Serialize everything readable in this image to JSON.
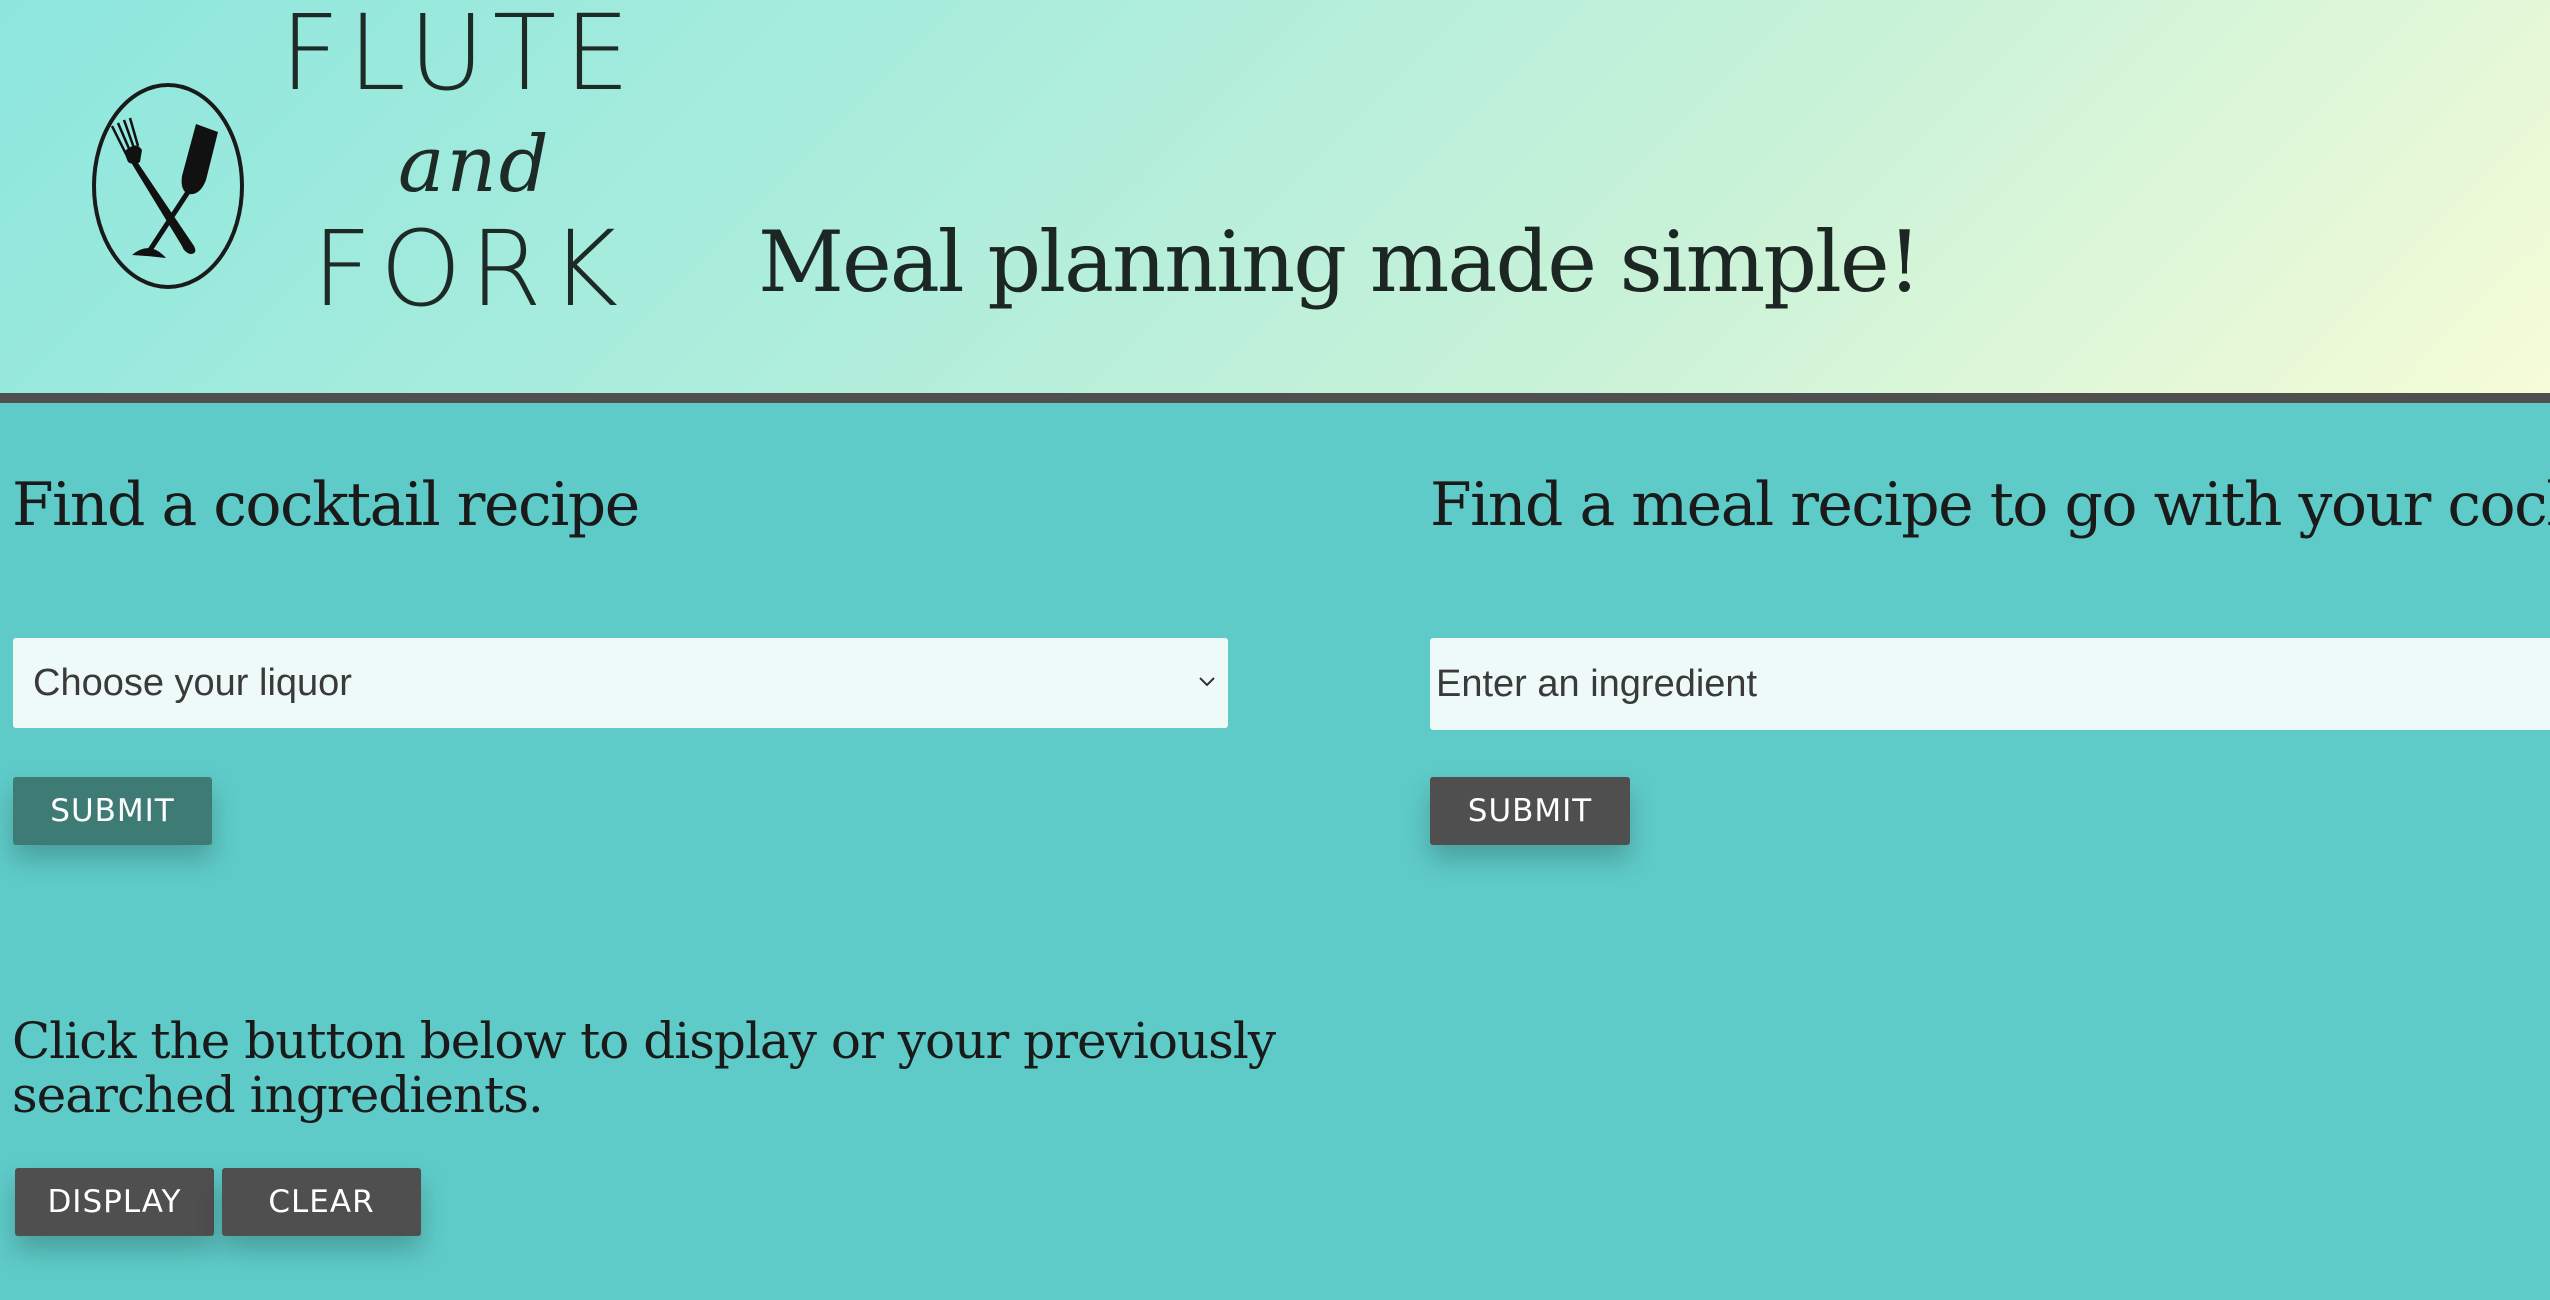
{
  "header": {
    "brand": {
      "line1": "FLUTE",
      "line2": "and",
      "line3": "FORK"
    },
    "tagline": "Meal planning made simple!"
  },
  "cocktail": {
    "title": "Find a cocktail recipe",
    "select": {
      "selected": "Choose your liquor"
    },
    "submit_label": "SUBMIT"
  },
  "meal": {
    "title": "Find a meal recipe to go with your cocktail",
    "input": {
      "value": "",
      "placeholder": "Enter an ingredient"
    },
    "submit_label": "SUBMIT"
  },
  "history": {
    "text": "Click the button below to display or your previously searched ingredients.",
    "display_label": "DISPLAY",
    "clear_label": "CLEAR"
  },
  "icons": {
    "logo": "fork-and-champagne-flute-logo-icon",
    "select_arrow": "chevron-down-icon"
  },
  "colors": {
    "page_background": "#5ecbc8",
    "header_gradient_start": "#8de6dd",
    "header_gradient_end": "#f6fcd7",
    "header_rule": "#4f4f4f",
    "button_dark": "#4f4f4f",
    "button_teal": "#3d7b74",
    "field_background": "#eefaf8"
  }
}
